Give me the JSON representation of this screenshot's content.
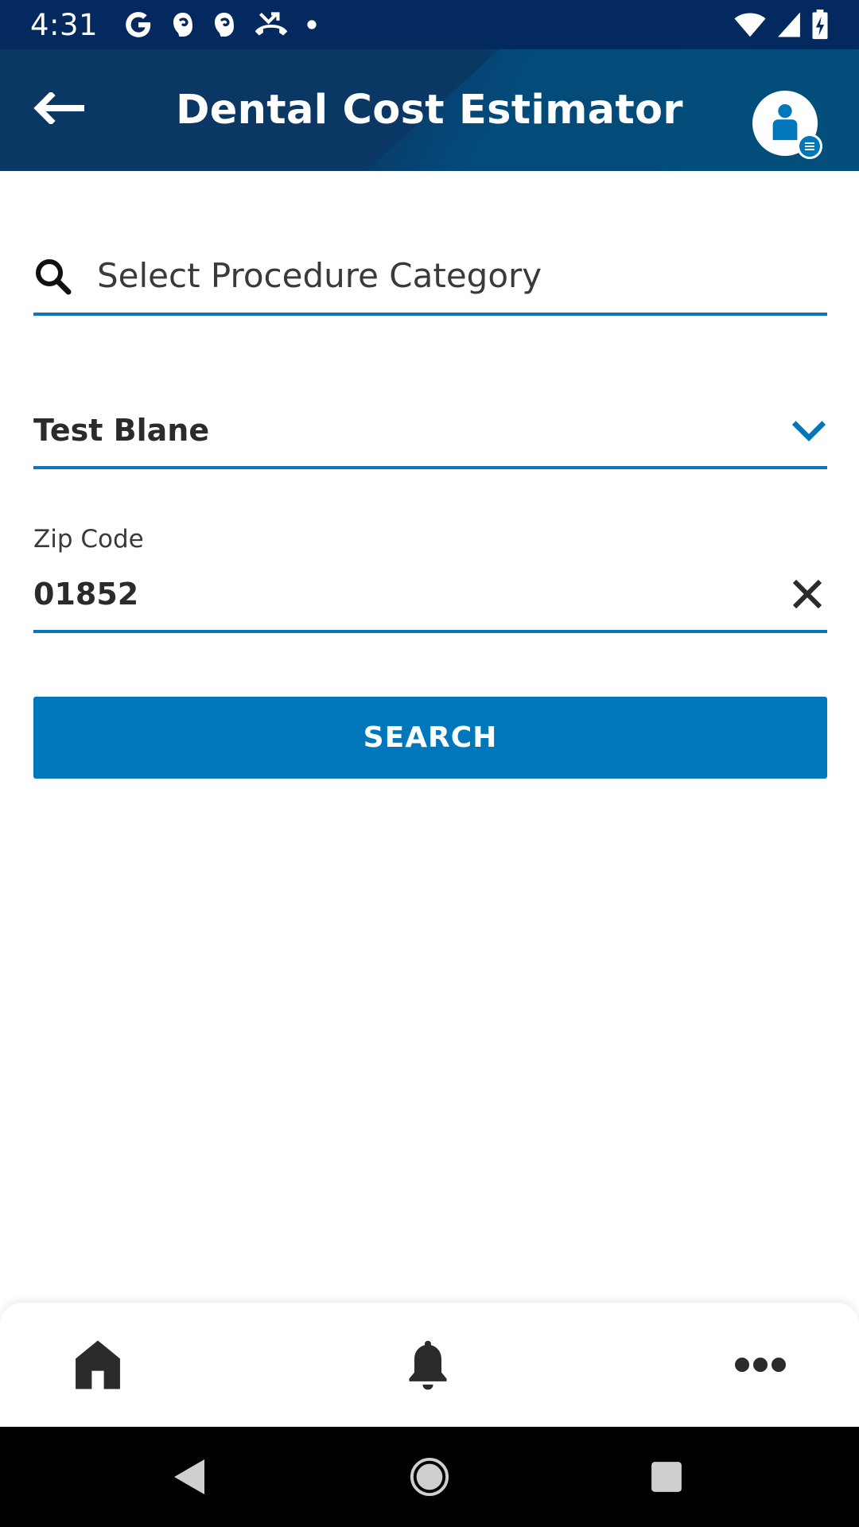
{
  "status_bar": {
    "time": "4:31",
    "left_icons": [
      "google-icon",
      "app-notification-icon",
      "app-notification-icon",
      "missed-call-icon",
      "dot-icon"
    ],
    "right_icons": [
      "wifi-icon",
      "cell-signal-icon",
      "battery-charging-icon"
    ]
  },
  "app_bar": {
    "title": "Dental Cost Estimator",
    "back_icon": "arrow-left-icon",
    "profile_icon": "user-profile-icon"
  },
  "procedure_search": {
    "placeholder": "Select Procedure Category",
    "value": "",
    "icon": "search-icon"
  },
  "plan_select": {
    "selected_value": "Test Blane",
    "icon": "chevron-down-icon"
  },
  "zip_code": {
    "label": "Zip Code",
    "value": "01852",
    "clear_icon": "close-icon"
  },
  "search_button": {
    "label": "SEARCH"
  },
  "bottom_nav": {
    "items": [
      {
        "name": "home",
        "icon": "home-icon"
      },
      {
        "name": "alerts",
        "icon": "bell-icon"
      },
      {
        "name": "more",
        "icon": "more-horizontal-icon"
      }
    ]
  },
  "system_nav": {
    "buttons": [
      "back-triangle-icon",
      "home-circle-icon",
      "recents-square-icon"
    ]
  },
  "colors": {
    "status_bar_bg": "#03295e",
    "app_bar_bg": "#0a3764",
    "accent_blue": "#0077bb",
    "field_underline": "#0876bd",
    "text_dark": "#2b2b2b"
  }
}
